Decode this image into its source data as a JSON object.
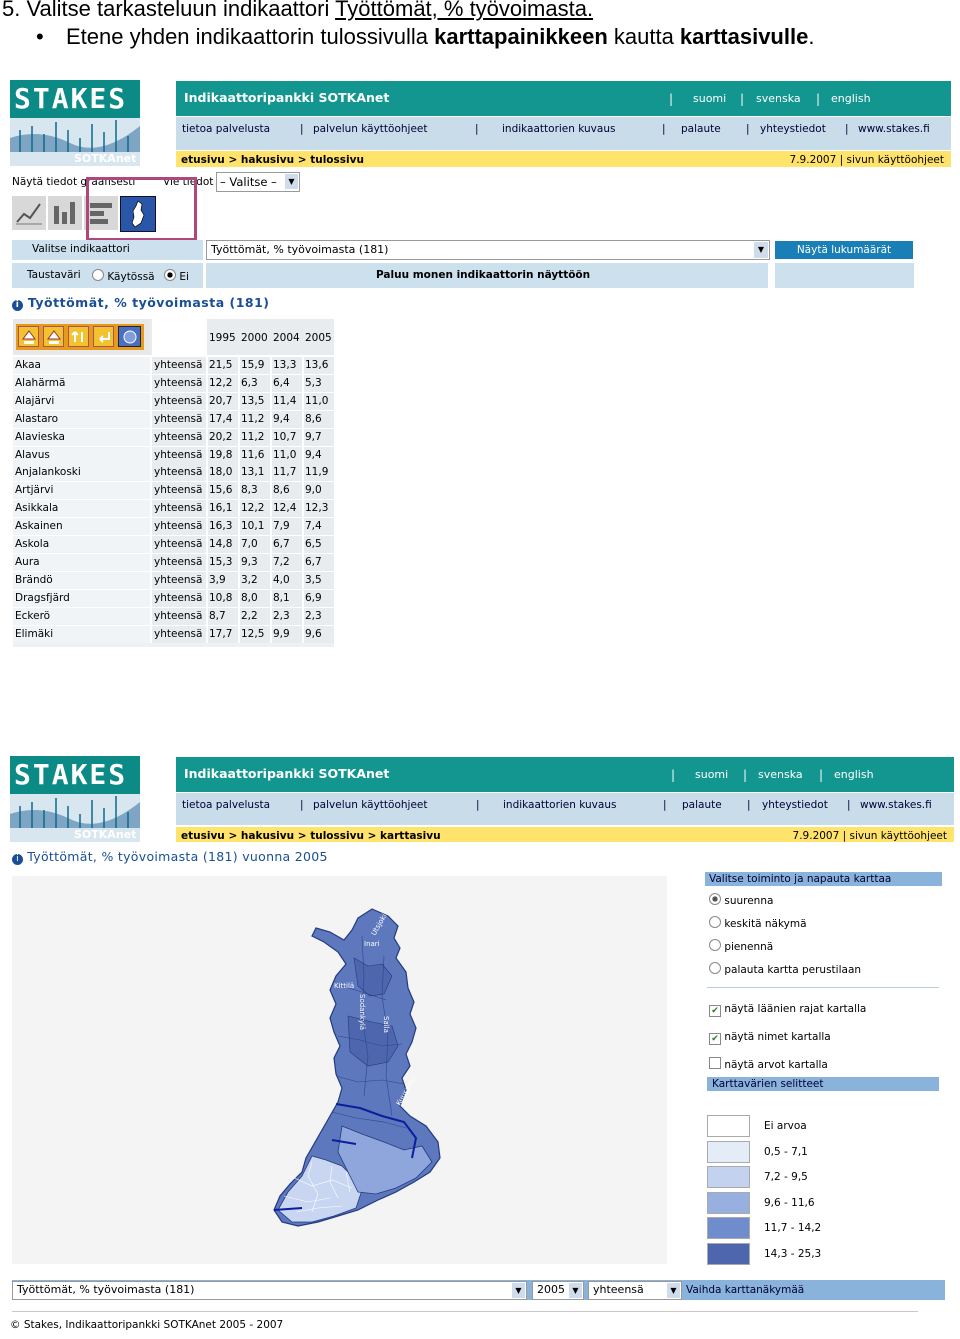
{
  "heading": {
    "num": "5.",
    "text": "Valitse tarkasteluun indikaattori",
    "link": "Työttömät, % työvoimasta.",
    "bullet_a": "Etene yhden indikaattorin tulossivulla ",
    "bullet_b": "karttapainikkeen",
    "bullet_c": " kautta ",
    "bullet_d": "karttasivulle",
    "bullet_e": "."
  },
  "site": {
    "logo_text": "STAKES",
    "logo_sub": "SOTKAnet",
    "title": "Indikaattoripankki SOTKAnet",
    "langs": [
      "suomi",
      "svenska",
      "english"
    ],
    "nav": [
      "tietoa palvelusta",
      "palvelun käyttöohjeet",
      "indikaattorien kuvaus",
      "palaute",
      "yhteystiedot",
      "www.stakes.fi"
    ],
    "date": "7.9.2007",
    "help": "sivun käyttöohjeet"
  },
  "s1": {
    "crumbs": [
      "etusivu",
      "hakusivu",
      "tulossivu"
    ],
    "show_label": "Näytä tiedot graafisesti",
    "export_label": "Vie tiedot",
    "export_value": "– Valitse –",
    "select_ind_label": "Valitse indikaattori",
    "indicator": "Työttömät, % työvoimasta (181)",
    "show_counts": "Näytä lukumäärät",
    "bg_label": "Taustaväri",
    "bg_on": "Käytössä",
    "bg_off": "Ei",
    "return_multi": "Paluu monen indikaattorin näyttöön",
    "table_title": "Työttömät, % työvoimasta (181)",
    "years": [
      "1995",
      "2000",
      "2004",
      "2005"
    ],
    "rows": [
      [
        "Akaa",
        "yhteensä",
        "21,5",
        "15,9",
        "13,3",
        "13,6"
      ],
      [
        "Alahärmä",
        "yhteensä",
        "12,2",
        "6,3",
        "6,4",
        "5,3"
      ],
      [
        "Alajärvi",
        "yhteensä",
        "20,7",
        "13,5",
        "11,4",
        "11,0"
      ],
      [
        "Alastaro",
        "yhteensä",
        "17,4",
        "11,2",
        "9,4",
        "8,6"
      ],
      [
        "Alavieska",
        "yhteensä",
        "20,2",
        "11,2",
        "10,7",
        "9,7"
      ],
      [
        "Alavus",
        "yhteensä",
        "19,8",
        "11,6",
        "11,0",
        "9,4"
      ],
      [
        "Anjalankoski",
        "yhteensä",
        "18,0",
        "13,1",
        "11,7",
        "11,9"
      ],
      [
        "Artjärvi",
        "yhteensä",
        "15,6",
        "8,3",
        "8,6",
        "9,0"
      ],
      [
        "Asikkala",
        "yhteensä",
        "16,1",
        "12,2",
        "12,4",
        "12,3"
      ],
      [
        "Askainen",
        "yhteensä",
        "16,3",
        "10,1",
        "7,9",
        "7,4"
      ],
      [
        "Askola",
        "yhteensä",
        "14,8",
        "7,0",
        "6,7",
        "6,5"
      ],
      [
        "Aura",
        "yhteensä",
        "15,3",
        "9,3",
        "7,2",
        "6,7"
      ],
      [
        "Brändö",
        "yhteensä",
        "3,9",
        "3,2",
        "4,0",
        "3,5"
      ],
      [
        "Dragsfjärd",
        "yhteensä",
        "10,8",
        "8,0",
        "8,1",
        "6,9"
      ],
      [
        "Eckerö",
        "yhteensä",
        "8,7",
        "2,2",
        "2,3",
        "2,3"
      ],
      [
        "Elimäki",
        "yhteensä",
        "17,7",
        "12,5",
        "9,9",
        "9,6"
      ]
    ]
  },
  "s2": {
    "crumbs": [
      "etusivu",
      "hakusivu",
      "tulossivu",
      "karttasivu"
    ],
    "map_title": "Työttömät, % työvoimasta (181) vuonna 2005",
    "map_labels": [
      "Utsjoki",
      "Inari",
      "Kittilä",
      "Sodankylä",
      "Salla",
      "Kuusamo"
    ],
    "panel_title": "Valitse toiminto ja napauta karttaa",
    "actions": [
      "suurenna",
      "keskitä näkymä",
      "pienennä",
      "palauta kartta perustilaan"
    ],
    "checks": [
      "näytä läänien rajat kartalla",
      "näytä nimet kartalla",
      "näytä arvot kartalla"
    ],
    "checks_state": [
      true,
      true,
      false
    ],
    "legend_title": "Karttavärien selitteet",
    "legend": [
      {
        "label": "Ei arvoa",
        "color": "#ffffff"
      },
      {
        "label": "0,5 - 7,1",
        "color": "#e4ecf7"
      },
      {
        "label": "7,2 - 9,5",
        "color": "#c3d3ef"
      },
      {
        "label": "9,6 - 11,6",
        "color": "#97b0e0"
      },
      {
        "label": "11,7 - 14,2",
        "color": "#6f8ccc"
      },
      {
        "label": "14,3 - 25,3",
        "color": "#4d66ad"
      }
    ],
    "indicator": "Työttömät, % työvoimasta (181)",
    "year": "2005",
    "sex": "yhteensä",
    "change_view": "Vaihda karttanäkymää",
    "footer": "© Stakes, Indikaattoripankki SOTKAnet 2005 - 2007"
  }
}
